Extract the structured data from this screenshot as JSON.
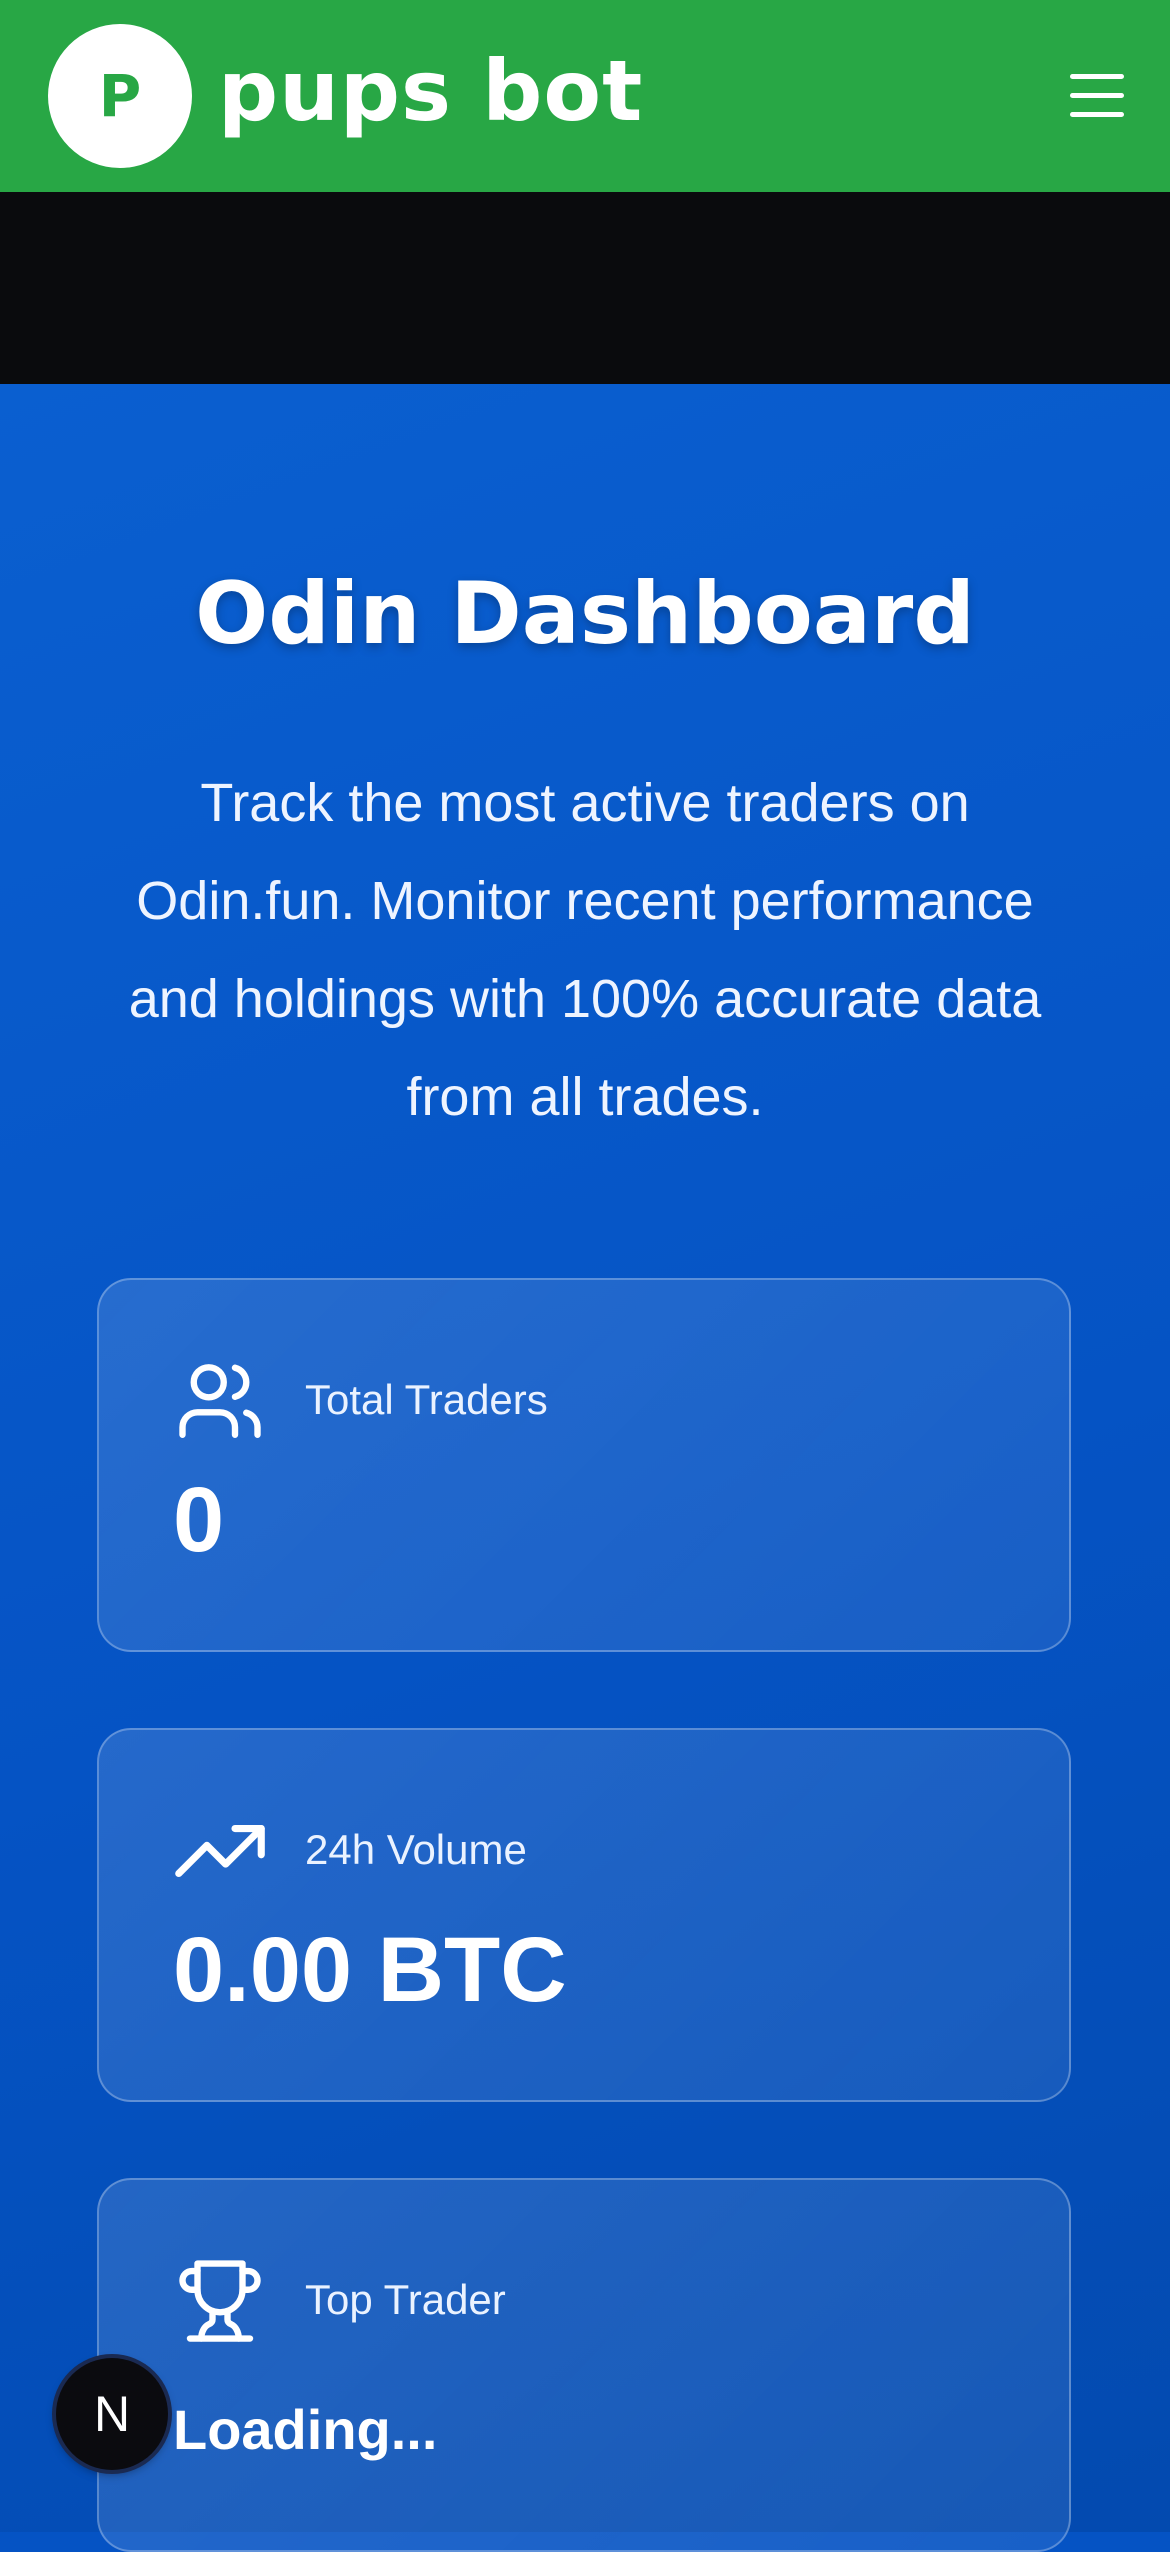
{
  "header": {
    "logo_letter": "P",
    "brand_name": "pups bot",
    "menu_icon": "hamburger-menu-icon"
  },
  "hero": {
    "title": "Odin Dashboard",
    "description": "Track the most active traders on Odin.fun. Monitor recent performance and holdings with 100% accurate data from all trades."
  },
  "stats": [
    {
      "icon": "users-icon",
      "label": "Total Traders",
      "value": "0"
    },
    {
      "icon": "trending-up-icon",
      "label": "24h Volume",
      "value": "0.00 BTC"
    },
    {
      "icon": "trophy-icon",
      "label": "Top Trader",
      "value": "Loading..."
    }
  ],
  "dev_badge": {
    "letter": "N"
  },
  "colors": {
    "header_bg": "#28a745",
    "band_bg": "#0a0b0d",
    "main_bg": "#0553c4",
    "text": "#ffffff"
  }
}
